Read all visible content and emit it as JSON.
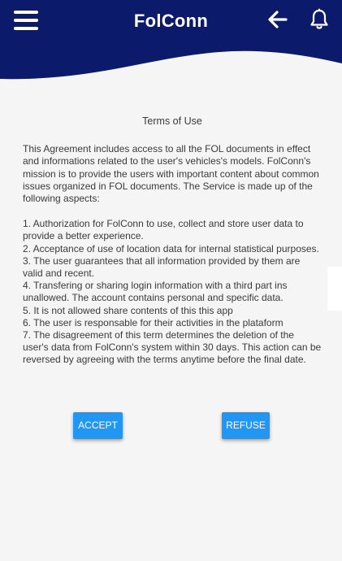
{
  "header": {
    "title": "FolConn",
    "background_color": "#0b1a6b",
    "icons": {
      "menu": "hamburger-menu-icon",
      "back": "arrow-left-icon",
      "notifications": "bell-icon"
    }
  },
  "terms": {
    "title": "Terms of Use",
    "intro": "This Agreement includes access to all the FOL documents in effect and informations related to the user's vehicles's models. FolConn's mission is to provide the users with important content about common issues organized in FOL documents. The Service is made up of the following aspects:",
    "items": [
      "1. Authorization for FolConn to use, collect and store user data to provide a better experience.",
      "2. Acceptance of use of location data for internal statistical purposes.",
      "3. The user guarantees that all information provided by them are valid and recent.",
      "4. Transfering or sharing login information with a third part ins unallowed. The account contains personal and specific data.",
      "5. It is not allowed share contents of this this app",
      "6. The user is responsable for their activities in the plataform",
      "7. The disagreement of this term determines the deletion of the user's data from FolConn's system within 30 days. This action can be reversed by agreeing with the terms anytime before the final date."
    ]
  },
  "actions": {
    "accept_label": "ACCEPT",
    "refuse_label": "REFUSE",
    "button_color": "#2196f3"
  }
}
